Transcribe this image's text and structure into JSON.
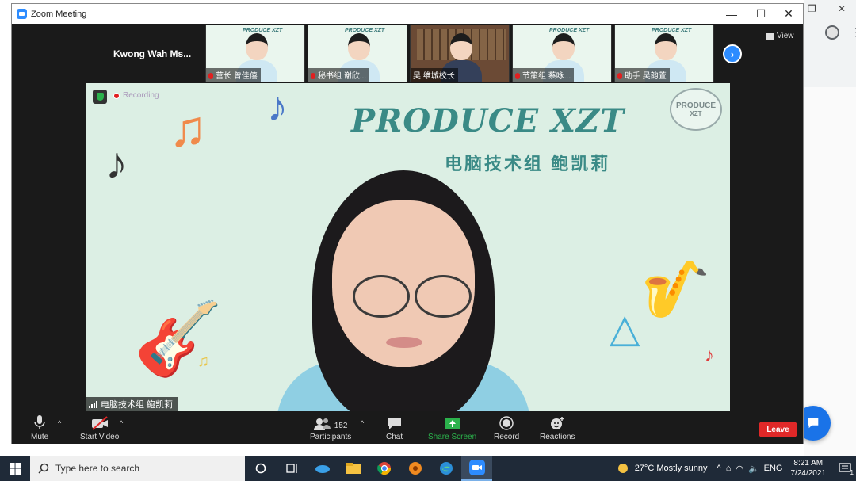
{
  "window": {
    "title": "Zoom Meeting"
  },
  "gallery": {
    "left_label": "Kwong Wah Ms...",
    "tiles": [
      {
        "name": "营长 曾佳僖",
        "banner": "PRODUCE XZT"
      },
      {
        "name": "秘书组 谢欣...",
        "banner": "PRODUCE XZT"
      },
      {
        "name": "吴 维城校长",
        "banner": ""
      },
      {
        "name": "节策组 蔡咏...",
        "banner": "PRODUCE XZT"
      },
      {
        "name": "助手 吴韵萱",
        "banner": "PRODUCE XZT"
      }
    ],
    "view_label": "View"
  },
  "main": {
    "recording_label": "Recording",
    "headline": "PRODUCE XZT",
    "subline": "电脑技术组 鲍凯莉",
    "logo_top": "PRODUCE",
    "logo_bottom": "XZT",
    "speaker_name": "电脑技术组 鲍凯莉"
  },
  "toolbar": {
    "mute": "Mute",
    "start_video": "Start Video",
    "participants": "Participants",
    "participants_count": "152",
    "chat": "Chat",
    "share_screen": "Share Screen",
    "record": "Record",
    "reactions": "Reactions",
    "leave": "Leave"
  },
  "taskbar": {
    "search_placeholder": "Type here to search",
    "weather": "27°C  Mostly sunny",
    "language": "ENG",
    "time": "8:21 AM",
    "date": "7/24/2021",
    "notification_count": "1"
  },
  "colors": {
    "zoom_blue": "#2d8cff",
    "leave_red": "#e02828",
    "share_green": "#2bb24c",
    "headline_teal": "#3a8a86"
  }
}
